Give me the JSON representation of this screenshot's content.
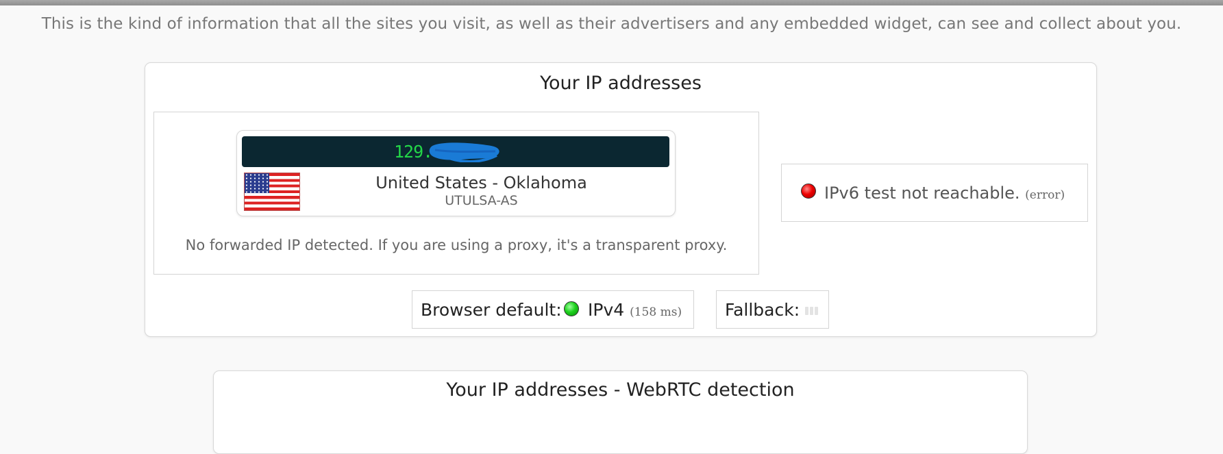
{
  "intro": "This is the kind of information that all the sites you visit, as well as their advertisers and any embedded widget, can see and collect about you.",
  "ip_card": {
    "title": "Your IP addresses",
    "ip_visible": "129.",
    "location": "United States - Oklahoma",
    "asn": "UTULSA-AS",
    "flag": "us-flag",
    "forwarded_note": "No forwarded IP detected. If you are using a proxy, it's a transparent proxy.",
    "ipv6": {
      "status_color": "#dd0000",
      "text": "IPv6 test not reachable.",
      "note": "(error)"
    },
    "browser_default": {
      "label": "Browser default:",
      "status_color": "#1dd11d",
      "protocol": "IPv4",
      "latency": "(158 ms)"
    },
    "fallback": {
      "label": "Fallback:"
    }
  },
  "webrtc_card": {
    "title": "Your IP addresses - WebRTC detection"
  },
  "colors": {
    "ip_display_bg": "#0b2731",
    "ip_digits": "#23d648",
    "redaction": "#1a7bd6"
  }
}
